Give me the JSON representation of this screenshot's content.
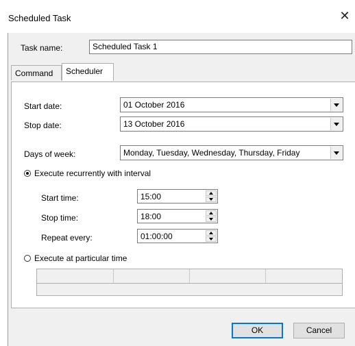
{
  "window": {
    "title": "Scheduled Task",
    "close_glyph": "✕"
  },
  "task_name": {
    "label": "Task name:",
    "value": "Scheduled Task 1"
  },
  "tabs": [
    {
      "label": "Command"
    },
    {
      "label": "Scheduler"
    }
  ],
  "scheduler": {
    "start_date": {
      "label": "Start date:",
      "value": "01 October 2016"
    },
    "stop_date": {
      "label": "Stop date:",
      "value": "13 October 2016"
    },
    "days_of_week": {
      "label": "Days of week:",
      "value": "Monday, Tuesday, Wednesday, Thursday, Friday"
    },
    "recurring": {
      "label": "Execute recurrently with interval",
      "selected": true
    },
    "start_time": {
      "label": "Start time:",
      "value": "15:00"
    },
    "stop_time": {
      "label": "Stop time:",
      "value": "18:00"
    },
    "repeat_every": {
      "label": "Repeat every:",
      "value": "01:00:00"
    },
    "particular": {
      "label": "Execute at particular time",
      "selected": false
    }
  },
  "buttons": {
    "ok": "OK",
    "cancel": "Cancel"
  }
}
